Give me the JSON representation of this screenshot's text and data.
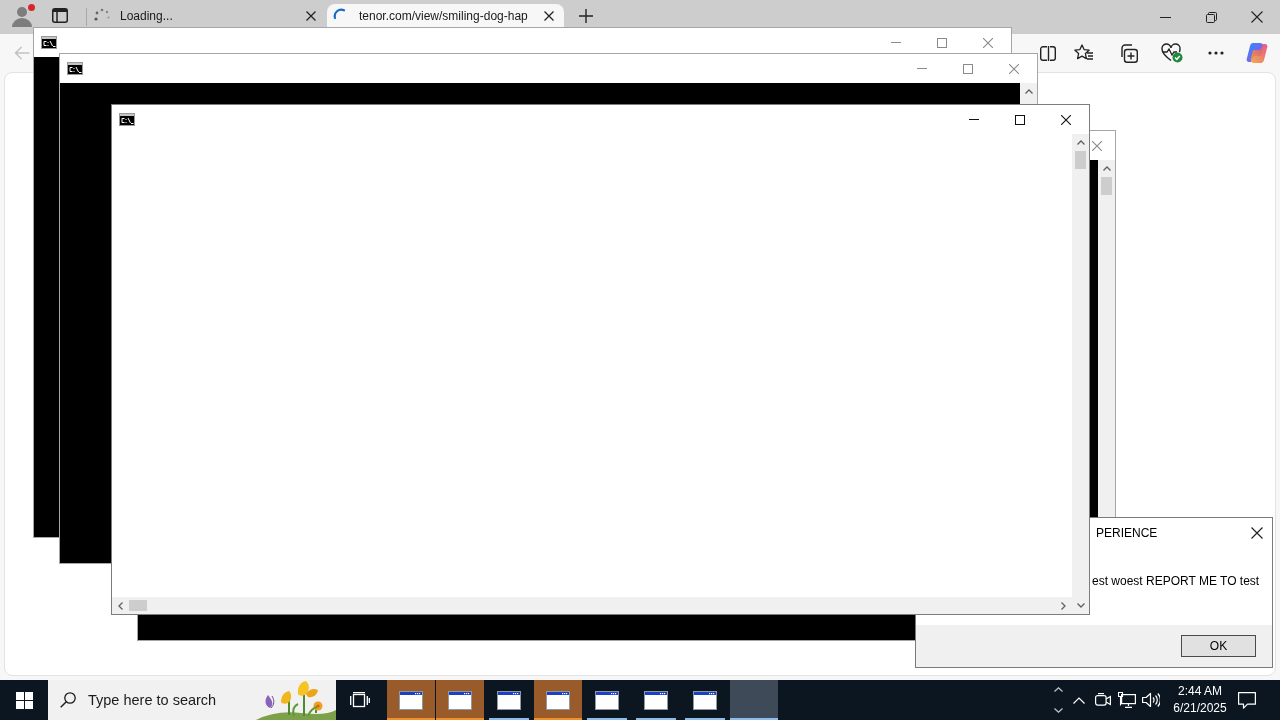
{
  "browser": {
    "profile_alert": true,
    "back_button": {
      "disabled": true
    },
    "tabs": [
      {
        "title": "Loading...",
        "selected": false
      },
      {
        "title": "tenor.com/view/smiling-dog-hap",
        "selected": true
      }
    ]
  },
  "windows": [
    {
      "kind": "console",
      "active": false
    },
    {
      "kind": "console",
      "active": false
    },
    {
      "kind": "console",
      "active": false
    },
    {
      "kind": "dialog",
      "title": "PERIENCE",
      "message": "est woest REPORT ME TO test",
      "button": "OK"
    },
    {
      "kind": "console",
      "active": true
    }
  ],
  "taskbar": {
    "search": {
      "placeholder": "Type here to search"
    },
    "apps": [
      {
        "kind": "window",
        "flashing": true,
        "selected": false
      },
      {
        "kind": "window",
        "flashing": true,
        "selected": false
      },
      {
        "kind": "window",
        "flashing": false,
        "selected": false
      },
      {
        "kind": "window",
        "flashing": true,
        "selected": false
      },
      {
        "kind": "window",
        "flashing": false,
        "selected": false
      },
      {
        "kind": "window",
        "flashing": false,
        "selected": false
      },
      {
        "kind": "window",
        "flashing": false,
        "selected": false
      },
      {
        "kind": "blank",
        "flashing": false,
        "selected": true
      }
    ],
    "clock": {
      "time": "2:44 AM",
      "date": "6/21/2025"
    }
  }
}
